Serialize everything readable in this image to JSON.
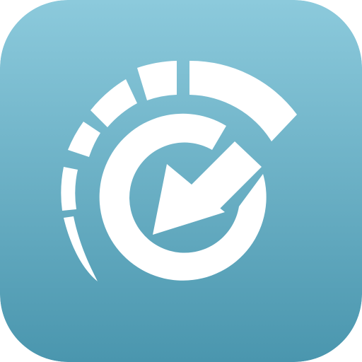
{
  "app_icon": {
    "name": "clock-arrow-icon",
    "colors": {
      "background_top": "#8CCADC",
      "background_bottom": "#4A96AE",
      "glyph": "#FFFFFF"
    }
  }
}
